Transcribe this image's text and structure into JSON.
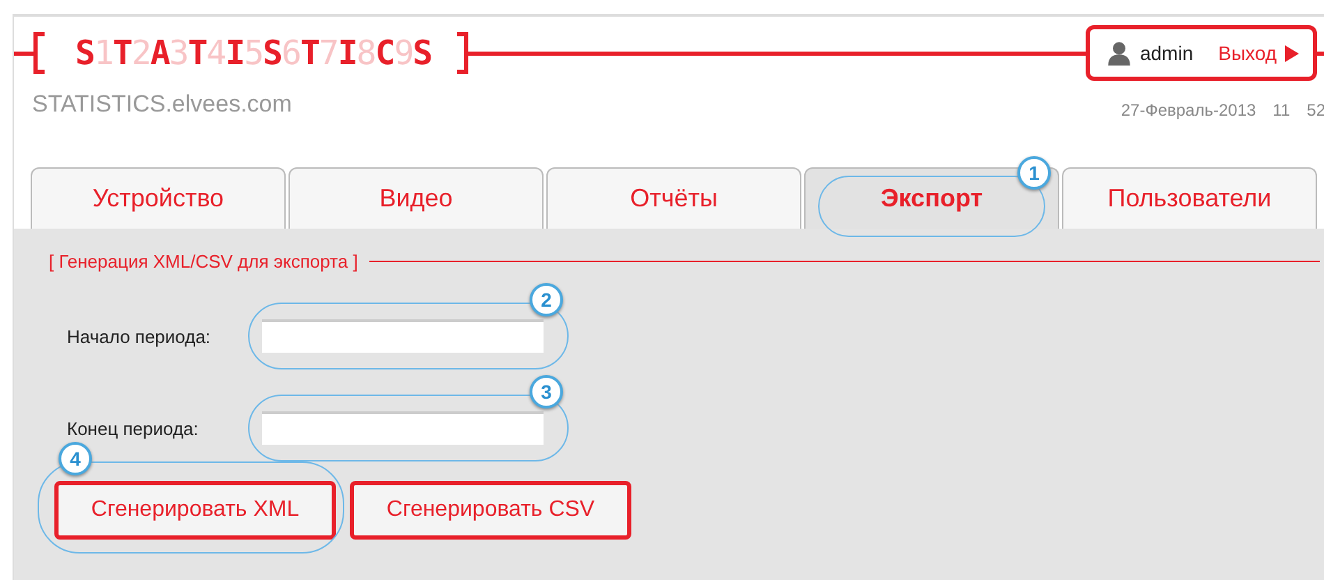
{
  "logo": [
    {
      "text": "S",
      "faded": false
    },
    {
      "text": "1",
      "faded": true
    },
    {
      "text": "T",
      "faded": false
    },
    {
      "text": "2",
      "faded": true
    },
    {
      "text": "A",
      "faded": false
    },
    {
      "text": "3",
      "faded": true
    },
    {
      "text": "T",
      "faded": false
    },
    {
      "text": "4",
      "faded": true
    },
    {
      "text": "I",
      "faded": false
    },
    {
      "text": "5",
      "faded": true
    },
    {
      "text": "S",
      "faded": false
    },
    {
      "text": "6",
      "faded": true
    },
    {
      "text": "T",
      "faded": false
    },
    {
      "text": "7",
      "faded": true
    },
    {
      "text": "I",
      "faded": false
    },
    {
      "text": "8",
      "faded": true
    },
    {
      "text": "C",
      "faded": false
    },
    {
      "text": "9",
      "faded": true
    },
    {
      "text": "S",
      "faded": false
    }
  ],
  "user": {
    "name": "admin",
    "logout": "Выход"
  },
  "site": "STATISTICS.elvees.com",
  "datetime": [
    "27-Февраль-2013",
    "11",
    "52"
  ],
  "tabs": [
    {
      "label": "Устройство",
      "selected": false
    },
    {
      "label": "Видео",
      "selected": false
    },
    {
      "label": "Отчёты",
      "selected": false
    },
    {
      "label": "Экспорт",
      "selected": true,
      "callout": "1"
    },
    {
      "label": "Пользователи",
      "selected": false
    }
  ],
  "section_title": "[ Генерация XML/CSV для экспорта ]",
  "fields": [
    {
      "label": "Начало периода:",
      "callout": "2"
    },
    {
      "label": "Конец периода:",
      "callout": "3"
    }
  ],
  "buttons": [
    {
      "label": "Сгенерировать XML",
      "callout": "4"
    },
    {
      "label": "Сгенерировать CSV"
    }
  ]
}
